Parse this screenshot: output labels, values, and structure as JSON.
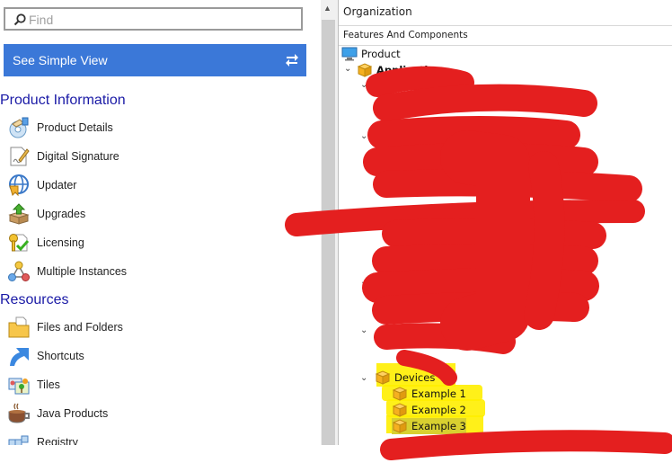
{
  "find": {
    "placeholder": "Find",
    "icon": "search-icon"
  },
  "simple_view_button": {
    "label": "See Simple View",
    "icon": "swap-arrows-icon",
    "color": "#3b78d8"
  },
  "sections": [
    {
      "title": "Product Information",
      "items": [
        {
          "label": "Product Details",
          "icon": "product-details-icon"
        },
        {
          "label": "Digital Signature",
          "icon": "digital-signature-icon"
        },
        {
          "label": "Updater",
          "icon": "updater-globe-icon"
        },
        {
          "label": "Upgrades",
          "icon": "upgrades-box-icon"
        },
        {
          "label": "Licensing",
          "icon": "licensing-key-icon"
        },
        {
          "label": "Multiple Instances",
          "icon": "multiple-instances-icon"
        }
      ]
    },
    {
      "title": "Resources",
      "items": [
        {
          "label": "Files and Folders",
          "icon": "folder-icon"
        },
        {
          "label": "Shortcuts",
          "icon": "shortcut-arrow-icon"
        },
        {
          "label": "Tiles",
          "icon": "tiles-icon"
        },
        {
          "label": "Java Products",
          "icon": "java-cup-icon"
        },
        {
          "label": "Registry",
          "icon": "registry-icon"
        }
      ]
    }
  ],
  "right_panel": {
    "title": "Organization",
    "subheader": "Features And Components",
    "tree": {
      "root": "Product",
      "application": "Application",
      "devices": "Devices",
      "device_children": [
        "Example 1",
        "Example 2",
        "Example 3"
      ]
    },
    "redaction_color": "#e41f1f",
    "highlight_color": "#ffee00"
  }
}
